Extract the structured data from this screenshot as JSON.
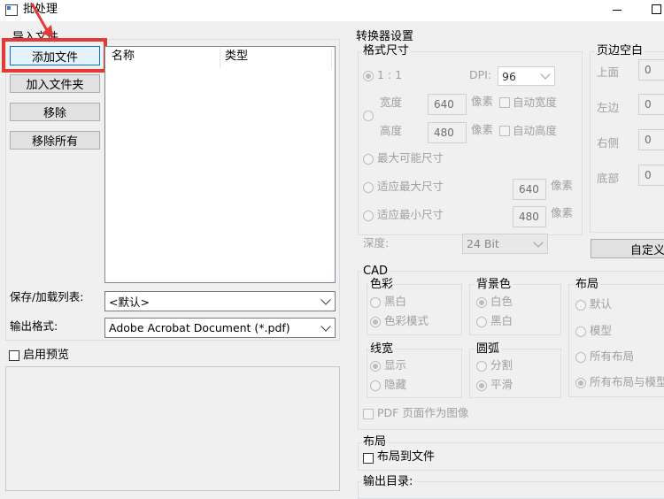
{
  "window": {
    "title": "批处理",
    "maximize_glyph": "☐"
  },
  "import": {
    "group_title": "导入文件",
    "buttons": [
      "添加文件",
      "加入文件夹",
      "移除",
      "移除所有"
    ],
    "columns": [
      "名称",
      "类型"
    ],
    "save_load_label": "保存/加载列表:",
    "save_load_value": "<默认>",
    "output_format_label": "输出格式:",
    "output_format_value": "Adobe Acrobat Document (*.pdf)",
    "preview_label": "启用预览"
  },
  "converter": {
    "title": "转换器设置",
    "format_size": {
      "title": "格式尺寸",
      "ratio_label": "1 : 1",
      "dpi_label": "DPI:",
      "dpi_value": "96",
      "width_label": "宽度",
      "width_value": "640",
      "height_label": "高度",
      "height_value": "480",
      "unit_px": "像素",
      "auto_width": "自动宽度",
      "auto_height": "自动高度",
      "max_possible": "最大可能尺寸",
      "fit_max": "适应最大尺寸",
      "fit_max_value": "640",
      "fit_min": "适应最小尺寸",
      "fit_min_value": "480",
      "depth_label": "深度:",
      "depth_value": "24 Bit"
    },
    "margins": {
      "title": "页边空白",
      "top": "上面",
      "left": "左边",
      "right": "右侧",
      "bottom": "底部",
      "top_value": "0",
      "left_value": "0",
      "right_value": "0",
      "bottom_value": "0",
      "custom_button": "自定义"
    },
    "cad": {
      "title": "CAD",
      "color": {
        "title": "色彩",
        "options": [
          "黑白",
          "色彩模式"
        ]
      },
      "background": {
        "title": "背景色",
        "options": [
          "白色",
          "黑白"
        ]
      },
      "layout": {
        "title": "布局",
        "options": [
          "默认",
          "模型",
          "所有布局",
          "所有布局与模型"
        ]
      },
      "linewidth": {
        "title": "线宽",
        "options": [
          "显示",
          "隐藏"
        ]
      },
      "arc": {
        "title": "圆弧",
        "options": [
          "分割",
          "平滑"
        ]
      },
      "pdf_as_image": "PDF 页面作为图像"
    },
    "layout_section": {
      "title": "布局",
      "layout_to_file": "布局到文件"
    },
    "output_dir": {
      "title": "输出目录:"
    }
  },
  "colors": {
    "highlight": "#e53935",
    "accent": "#0078d7"
  }
}
